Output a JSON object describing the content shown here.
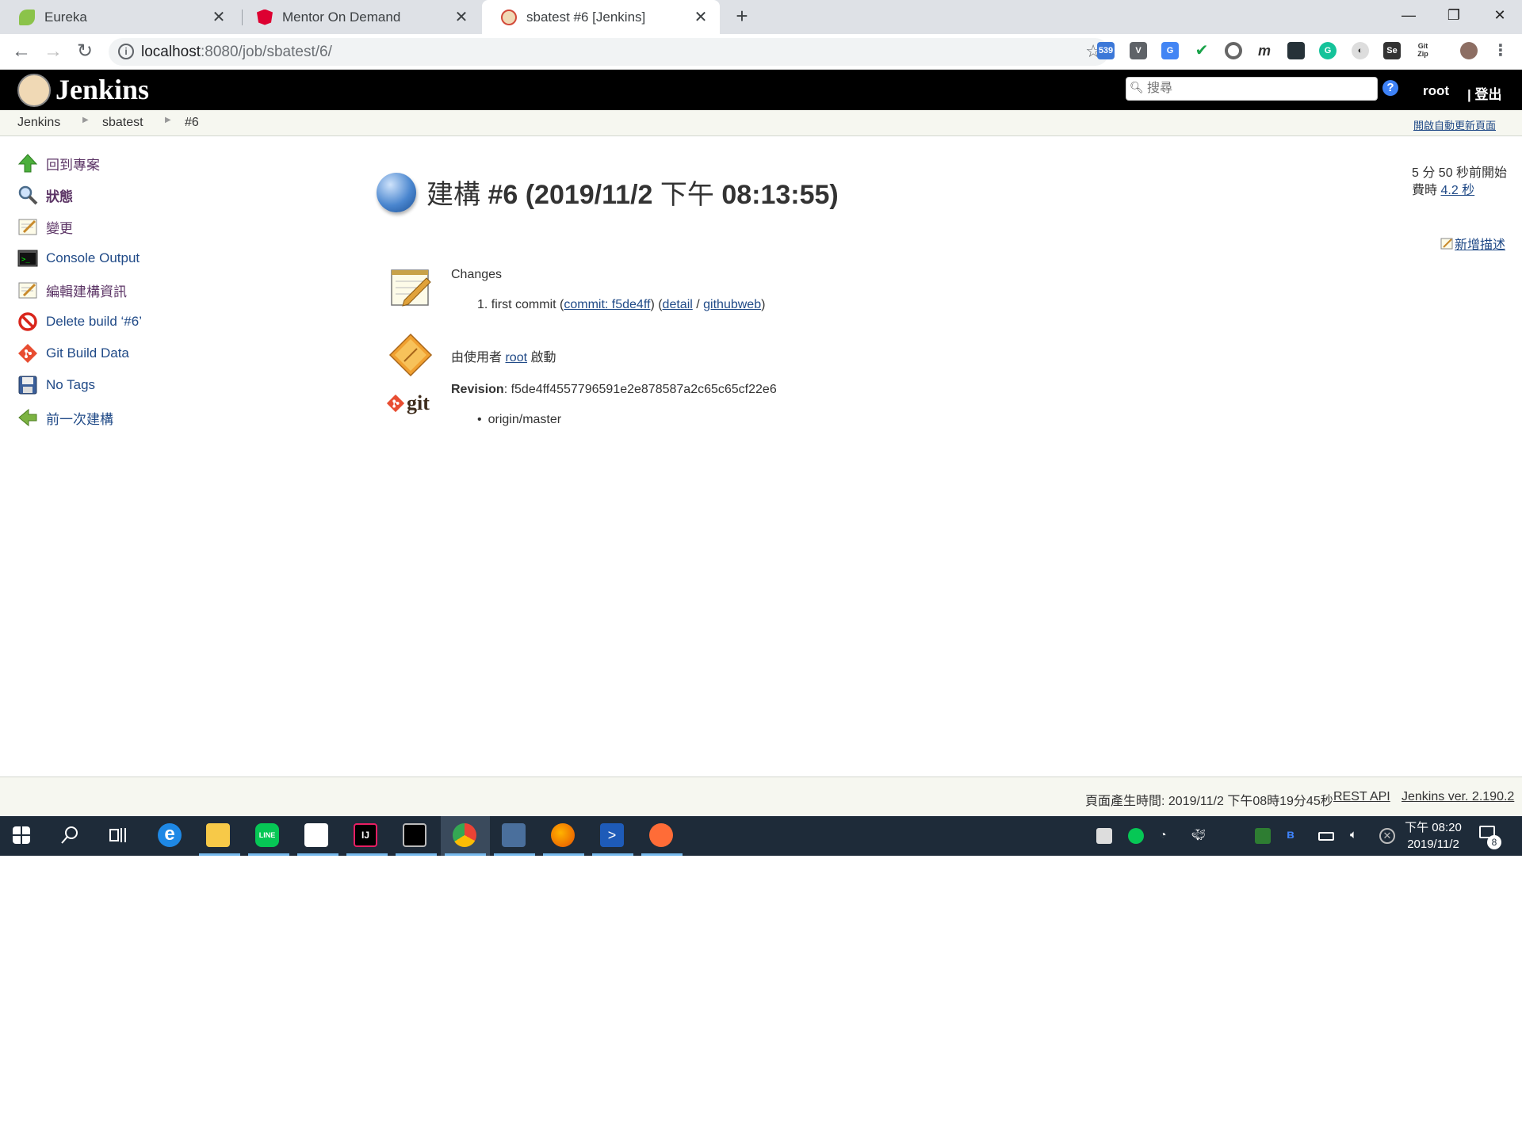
{
  "browser": {
    "tabs": [
      {
        "title": "Eureka",
        "favicon_color": "#8bc34a",
        "active": false
      },
      {
        "title": "Mentor On Demand",
        "favicon_color": "#dd0031",
        "active": false
      },
      {
        "title": "sbatest #6 [Jenkins]",
        "favicon_color": "#d24939",
        "active": true
      }
    ],
    "url_host": "localhost",
    "url_rest": ":8080/job/sbatest/6/",
    "extension_badge": "539"
  },
  "jenkins": {
    "title": "Jenkins",
    "search_placeholder": "搜尋",
    "help": "?",
    "user": "root",
    "logout": "| 登出",
    "breadcrumbs": [
      "Jenkins",
      "sbatest",
      "#6"
    ],
    "auto_refresh": "開啟自動更新頁面"
  },
  "side_tasks": [
    {
      "label": "回到專案",
      "icon": "up-arrow-icon"
    },
    {
      "label": "狀態",
      "icon": "search-icon"
    },
    {
      "label": "變更",
      "icon": "notepad-icon"
    },
    {
      "label": "Console Output",
      "icon": "terminal-icon"
    },
    {
      "label": "編輯建構資訊",
      "icon": "notepad-icon"
    },
    {
      "label": "Delete build ‘#6’",
      "icon": "no-entry-icon"
    },
    {
      "label": "Git Build Data",
      "icon": "git-icon"
    },
    {
      "label": "No Tags",
      "icon": "save-icon"
    },
    {
      "label": "前一次建構",
      "icon": "left-arrow-icon"
    }
  ],
  "build": {
    "title_prefix": "建構",
    "title_number": "#6 (2019/11/2",
    "title_ampm": "下午",
    "title_time": "08:13:55)",
    "started": "5 分 50 秒前開始",
    "took_label": "費時",
    "took_value": "4.2 秒",
    "add_description": "新增描述",
    "changes_heading": "Changes",
    "change_item_num": "1.",
    "change_item_text": "first commit (",
    "change_commit": "commit: f5de4ff",
    "change_paren_close": ") (",
    "change_detail": "detail",
    "change_slash": " / ",
    "change_githubweb": "githubweb",
    "change_end": ")",
    "started_by_prefix": "由使用者",
    "started_by_user": "root",
    "started_by_suffix": "啟動",
    "revision_label": "Revision",
    "revision_value": ": f5de4ff4557796591e2e878587a2c65c65cf22e6",
    "branch": "origin/master"
  },
  "footer": {
    "generated": "頁面產生時間: 2019/11/2 下午08時19分45秒",
    "rest_api": "REST API",
    "version": "Jenkins ver. 2.190.2"
  },
  "taskbar": {
    "clock_time": "下午 08:20",
    "clock_date": "2019/11/2",
    "notifications": "8"
  }
}
